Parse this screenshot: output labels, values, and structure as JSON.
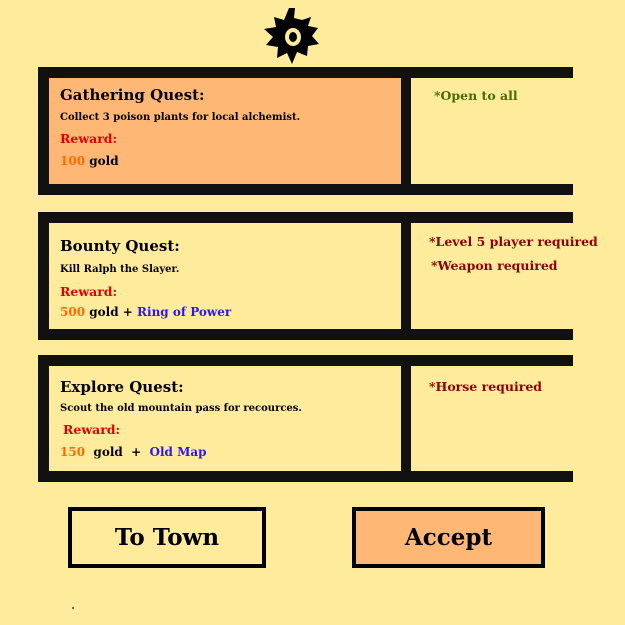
{
  "colors": {
    "background": "#ffeb9c",
    "highlight": "#ffb775",
    "frame": "#111111",
    "reward_label": "#e00000",
    "gold_amount": "#ff6a00",
    "item_reward": "#2a17ee",
    "requirement_open": "#4a6b00",
    "requirement_restricted": "#8b0000"
  },
  "emblem": {
    "icon": "guild-crest-icon"
  },
  "quests": [
    {
      "title": "Gathering Quest:",
      "description": "Collect 3 poison plants for local alchemist.",
      "reward_label": "Reward:",
      "gold": "100",
      "gold_word": "gold",
      "plus": "",
      "item": "",
      "requirements": [
        "*Open to all"
      ],
      "selected": true
    },
    {
      "title": "Bounty Quest:",
      "description": "Kill Ralph the Slayer.",
      "reward_label": "Reward:",
      "gold": "500",
      "gold_word": "gold",
      "plus": "+",
      "item": "Ring of Power",
      "requirements": [
        "*Level 5 player required",
        "*Weapon required"
      ],
      "selected": false
    },
    {
      "title": "Explore Quest:",
      "description": "Scout the old mountain pass for recources.",
      "reward_label": "Reward:",
      "gold": "150",
      "gold_word": "gold",
      "plus": "+",
      "item": "Old Map",
      "requirements": [
        "*Horse required"
      ],
      "selected": false
    }
  ],
  "buttons": {
    "to_town": "To Town",
    "accept": "Accept"
  }
}
